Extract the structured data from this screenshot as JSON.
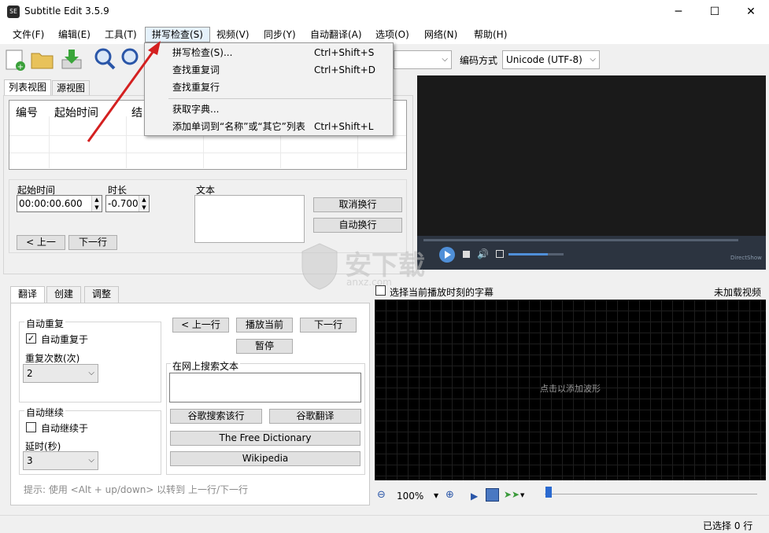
{
  "window": {
    "title": "Subtitle Edit 3.5.9",
    "icon_text": "SE"
  },
  "menubar": [
    "文件(F)",
    "编辑(E)",
    "工具(T)",
    "拼写检查(S)",
    "视频(V)",
    "同步(Y)",
    "自动翻译(A)",
    "选项(O)",
    "网络(N)",
    "帮助(H)"
  ],
  "spell_menu": {
    "items": [
      {
        "label": "拼写检查(S)...",
        "shortcut": "Ctrl+Shift+S"
      },
      {
        "label": "查找重复词",
        "shortcut": "Ctrl+Shift+D"
      },
      {
        "label": "查找重复行",
        "shortcut": ""
      },
      {
        "label": "获取字典...",
        "shortcut": ""
      },
      {
        "label": "添加单词到“名称”或“其它”列表",
        "shortcut": "Ctrl+Shift+L"
      }
    ]
  },
  "toolbar": {
    "encoding_label": "编码方式",
    "encoding_value": "Unicode (UTF-8)"
  },
  "left_tabs": [
    "列表视图",
    "源视图"
  ],
  "list": {
    "columns": [
      "编号",
      "起始时间",
      "结"
    ]
  },
  "edit": {
    "start_label": "起始时间",
    "start_value": "00:00:00.600",
    "duration_label": "时长",
    "duration_value": "-0.700",
    "text_label": "文本",
    "cancel_wrap": "取消换行",
    "auto_wrap": "自动换行",
    "prev": "< 上一",
    "next": "下一行"
  },
  "bottom_tabs": [
    "翻译",
    "创建",
    "调整"
  ],
  "translate": {
    "auto_repeat_title": "自动重复",
    "auto_repeat_check": "自动重复于",
    "repeat_count_label": "重复次数(次)",
    "repeat_count": "2",
    "auto_continue_title": "自动继续",
    "auto_continue_check": "自动继续于",
    "delay_label": "延时(秒)",
    "delay": "3",
    "prev_line": "< 上一行",
    "play_current": "播放当前",
    "next_line": "下一行",
    "pause": "暂停",
    "search_title": "在网上搜索文本",
    "google_search": "谷歌搜索该行",
    "google_translate": "谷歌翻译",
    "free_dictionary": "The Free Dictionary",
    "wikipedia": "Wikipedia",
    "hint": "提示: 使用 <Alt + up/down> 以转到 上一行/下一行"
  },
  "waveform": {
    "select_current": "选择当前播放时刻的字幕",
    "no_video": "未加载视频",
    "placeholder": "点击以添加波形",
    "zoom": "100%"
  },
  "video": {
    "brand": "DirectShow"
  },
  "statusbar": {
    "selection": "已选择 0 行"
  },
  "watermark": {
    "text": "安下载",
    "sub": "anxz.com"
  }
}
